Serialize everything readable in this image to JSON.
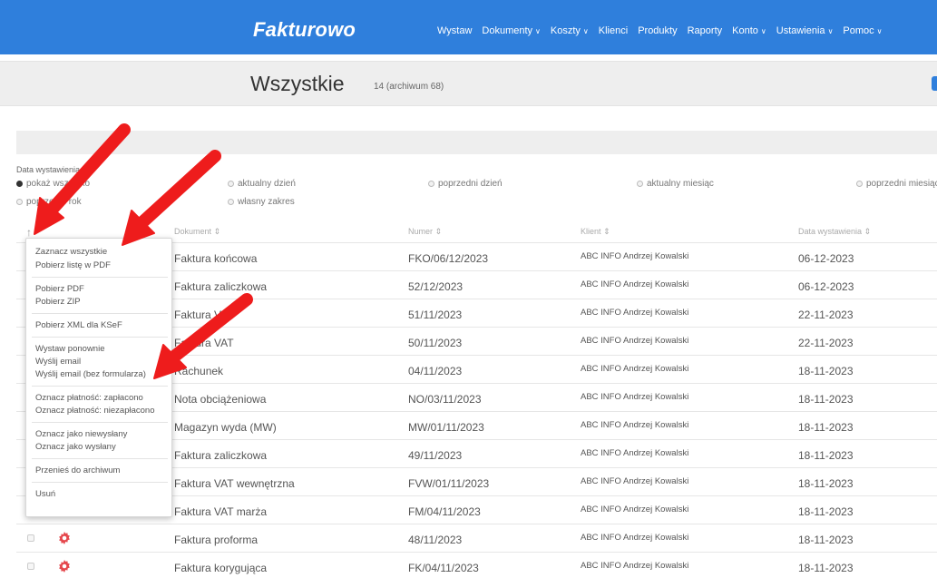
{
  "app": {
    "logo": "Fakturowo",
    "nav": [
      {
        "label": "Wystaw",
        "dropdown": false
      },
      {
        "label": "Dokumenty",
        "dropdown": true
      },
      {
        "label": "Koszty",
        "dropdown": true
      },
      {
        "label": "Klienci",
        "dropdown": false
      },
      {
        "label": "Produkty",
        "dropdown": false
      },
      {
        "label": "Raporty",
        "dropdown": false
      },
      {
        "label": "Konto",
        "dropdown": true
      },
      {
        "label": "Ustawienia",
        "dropdown": true
      },
      {
        "label": "Pomoc",
        "dropdown": true
      }
    ]
  },
  "header": {
    "title": "Wszystkie",
    "subtitle": "14 (archiwum 68)"
  },
  "filter": {
    "title": "Data wystawienia",
    "options": {
      "all": "pokaż wszystko",
      "today": "aktualny dzień",
      "prev_day": "poprzedni dzień",
      "cur_month": "aktualny miesiąc",
      "prev_month": "poprzedni miesiąc",
      "prev_year": "poprzedni rok",
      "custom": "własny zakres"
    },
    "selected": "all"
  },
  "table": {
    "columns": {
      "document": "Dokument ⇕",
      "number": "Numer ⇕",
      "client": "Klient ⇕",
      "date": "Data wystawienia ⇕"
    },
    "rows": [
      {
        "document": "Faktura końcowa",
        "number": "FKO/06/12/2023",
        "client": "ABC INFO Andrzej Kowalski",
        "date": "06-12-2023"
      },
      {
        "document": "Faktura zaliczkowa",
        "number": "52/12/2023",
        "client": "ABC INFO Andrzej Kowalski",
        "date": "06-12-2023"
      },
      {
        "document": "Faktura VAT",
        "number": "51/11/2023",
        "client": "ABC INFO Andrzej Kowalski",
        "date": "22-11-2023"
      },
      {
        "document": "Faktura VAT",
        "number": "50/11/2023",
        "client": "ABC INFO Andrzej Kowalski",
        "date": "22-11-2023"
      },
      {
        "document": "Rachunek",
        "number": "04/11/2023",
        "client": "ABC INFO Andrzej Kowalski",
        "date": "18-11-2023"
      },
      {
        "document": "Nota obciążeniowa",
        "number": "NO/03/11/2023",
        "client": "ABC INFO Andrzej Kowalski",
        "date": "18-11-2023"
      },
      {
        "document": "Magazyn wyda (MW)",
        "number": "MW/01/11/2023",
        "client": "ABC INFO Andrzej Kowalski",
        "date": "18-11-2023"
      },
      {
        "document": "Faktura zaliczkowa",
        "number": "49/11/2023",
        "client": "ABC INFO Andrzej Kowalski",
        "date": "18-11-2023"
      },
      {
        "document": "Faktura VAT wewnętrzna",
        "number": "FVW/01/11/2023",
        "client": "ABC INFO Andrzej Kowalski",
        "date": "18-11-2023"
      },
      {
        "document": "Faktura VAT marża",
        "number": "FM/04/11/2023",
        "client": "ABC INFO Andrzej Kowalski",
        "date": "18-11-2023"
      },
      {
        "document": "Faktura proforma",
        "number": "48/11/2023",
        "client": "ABC INFO Andrzej Kowalski",
        "date": "18-11-2023"
      },
      {
        "document": "Faktura korygująca",
        "number": "FK/04/11/2023",
        "client": "ABC INFO Andrzej Kowalski",
        "date": "18-11-2023"
      }
    ]
  },
  "menu": {
    "select_all": "Zaznacz wszystkie",
    "list_pdf": "Pobierz listę w PDF",
    "get_pdf": "Pobierz PDF",
    "get_zip": "Pobierz ZIP",
    "get_xml": "Pobierz XML dla KSeF",
    "reissue": "Wystaw ponownie",
    "send_email": "Wyślij email",
    "send_email_noform": "Wyślij email (bez formularza)",
    "mark_paid": "Oznacz płatność: zapłacono",
    "mark_unpaid": "Oznacz płatność: niezapłacono",
    "mark_unsent": "Oznacz jako niewysłany",
    "mark_sent": "Oznacz jako wysłany",
    "archive": "Przenieś do archiwum",
    "delete": "Usuń"
  },
  "colors": {
    "brand": "#2f7fdc",
    "gear": "#e5484d",
    "arrow": "#ee1c1c"
  }
}
